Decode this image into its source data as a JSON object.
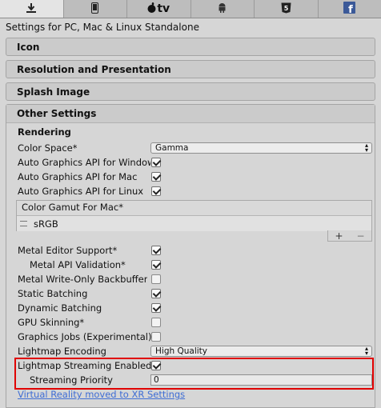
{
  "platform_tabs": [
    {
      "name": "standalone",
      "glyph": "⬇",
      "active": true
    },
    {
      "name": "ios",
      "glyph": "▯",
      "active": false
    },
    {
      "name": "tvos",
      "glyph": "tv",
      "active": false
    },
    {
      "name": "android",
      "glyph": "♟",
      "active": false
    },
    {
      "name": "webgl",
      "glyph": "5",
      "active": false
    },
    {
      "name": "facebook",
      "glyph": "f",
      "active": false
    }
  ],
  "settings_title": "Settings for PC, Mac & Linux Standalone",
  "sections": {
    "icon": "Icon",
    "resolution": "Resolution and Presentation",
    "splash": "Splash Image",
    "other": "Other Settings"
  },
  "rendering": {
    "heading": "Rendering",
    "color_space": {
      "label": "Color Space*",
      "value": "Gamma"
    },
    "api_windows": {
      "label": "Auto Graphics API  for Windows",
      "checked": true
    },
    "api_mac": {
      "label": "Auto Graphics API  for Mac",
      "checked": true
    },
    "api_linux": {
      "label": "Auto Graphics API  for Linux",
      "checked": true
    },
    "color_gamut": {
      "header": "Color Gamut For Mac*",
      "items": [
        "sRGB"
      ],
      "add": "+",
      "remove": "−"
    },
    "metal_editor": {
      "label": "Metal Editor Support*",
      "checked": true
    },
    "metal_api_validation": {
      "label": "Metal API Validation*",
      "checked": true
    },
    "metal_write_only": {
      "label": "Metal Write-Only Backbuffer",
      "checked": false
    },
    "static_batching": {
      "label": "Static Batching",
      "checked": true
    },
    "dynamic_batching": {
      "label": "Dynamic Batching",
      "checked": true
    },
    "gpu_skinning": {
      "label": "GPU Skinning*",
      "checked": false
    },
    "graphics_jobs": {
      "label": "Graphics Jobs (Experimental)*",
      "checked": false
    },
    "lightmap_encoding": {
      "label": "Lightmap Encoding",
      "value": "High Quality"
    },
    "lightmap_streaming": {
      "label": "Lightmap Streaming Enabled",
      "checked": true
    },
    "streaming_priority": {
      "label": "Streaming Priority",
      "value": "0"
    }
  },
  "vr_link": "Virtual Reality moved to XR Settings",
  "colors": {
    "highlight": "#e00000",
    "link": "#3f6ed5"
  }
}
